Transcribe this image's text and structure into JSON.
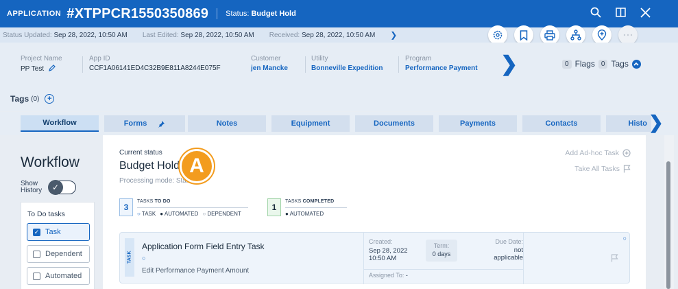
{
  "header": {
    "app_label": "APPLICATION",
    "app_id": "#XTPPCR1550350869",
    "status_label": "Status:",
    "status_value": "Budget Hold",
    "icons": [
      "search-icon",
      "split-view-icon",
      "close-icon"
    ]
  },
  "subheader": {
    "status_updated_label": "Status Updated:",
    "status_updated_value": "Sep 28, 2022, 10:50 AM",
    "last_edited_label": "Last Edited:",
    "last_edited_value": "Sep 28, 2022, 10:50 AM",
    "received_label": "Received:",
    "received_value": "Sep 28, 2022, 10:50 AM"
  },
  "action_icons": [
    "gear-icon",
    "bookmark-icon",
    "print-icon",
    "hierarchy-icon",
    "add-location-icon",
    "more-icon"
  ],
  "info": {
    "project_name_label": "Project Name",
    "project_name_value": "PP Test",
    "app_id_label": "App ID",
    "app_id_value": "CCF1A06141ED4C32B9E811A8244E075F",
    "customer_label": "Customer",
    "customer_value": "jen Mancke",
    "utility_label": "Utility",
    "utility_value": "Bonneville Expedition",
    "program_label": "Program",
    "program_value": "Performance Payment",
    "flags_count": "0",
    "flags_label": "Flags",
    "tags_count": "0",
    "tags_label": "Tags"
  },
  "tags": {
    "label": "Tags",
    "count": "(0)"
  },
  "tabs": [
    "Workflow",
    "Forms",
    "Notes",
    "Equipment",
    "Documents",
    "Payments",
    "Contacts",
    "Histo"
  ],
  "active_tab": "Workflow",
  "sidebar": {
    "title": "Workflow",
    "show_history_line1": "Show",
    "show_history_line2": "History",
    "todo_header": "To Do tasks",
    "filters": [
      {
        "label": "Task",
        "checked": true
      },
      {
        "label": "Dependent",
        "checked": false
      },
      {
        "label": "Automated",
        "checked": false
      }
    ]
  },
  "content": {
    "current_status_label": "Current status",
    "current_status_value": "Budget Hold",
    "processing_mode": "Processing mode: Standard",
    "badge": "A",
    "add_adhoc": "Add Ad-hoc Task",
    "take_all": "Take All Tasks",
    "todo": {
      "count": "3",
      "title_pre": "TASKS ",
      "title_bold": "TO DO",
      "legend": [
        "TASK",
        "AUTOMATED",
        "DEPENDENT"
      ]
    },
    "completed": {
      "count": "1",
      "title_pre": "TASKS ",
      "title_bold": "COMPLETED",
      "legend": [
        "AUTOMATED"
      ]
    }
  },
  "task": {
    "type_label": "TASK",
    "name": "Application Form Field Entry Task",
    "subtitle": "Edit Performance Payment Amount",
    "created_label": "Created:",
    "created_date": "Sep 28, 2022",
    "created_time": "10:50 AM",
    "term_label": "Term:",
    "term_value": "0 days",
    "due_label": "Due Date:",
    "due_value_1": "not",
    "due_value_2": "applicable",
    "assigned_label": "Assigned To:",
    "assigned_value": "-"
  },
  "colors": {
    "primary": "#1565c0",
    "badge": "#f39c1e",
    "page_bg": "#e8edf3"
  }
}
